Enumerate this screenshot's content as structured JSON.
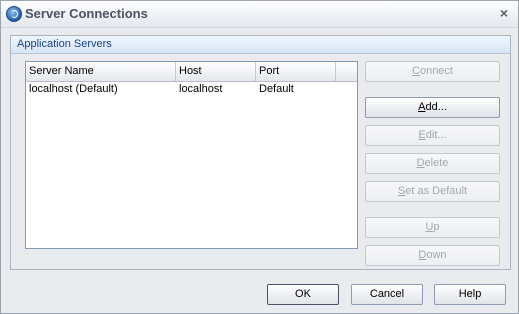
{
  "window": {
    "title": "Server Connections",
    "close_glyph": "×"
  },
  "group": {
    "title": "Application Servers"
  },
  "table": {
    "columns": [
      "Server Name",
      "Host",
      "Port"
    ],
    "rows": [
      {
        "name": "localhost (Default)",
        "host": "localhost",
        "port": "Default"
      }
    ]
  },
  "side_buttons": {
    "connect": {
      "label": "Connect",
      "access": "C",
      "rest": "onnect",
      "enabled": false
    },
    "add": {
      "label": "Add...",
      "access": "A",
      "rest": "dd...",
      "enabled": true
    },
    "edit": {
      "label": "Edit...",
      "access": "E",
      "rest": "dit...",
      "enabled": false
    },
    "delete": {
      "label": "Delete",
      "access": "D",
      "rest": "elete",
      "enabled": false
    },
    "set_default": {
      "label": "Set as Default",
      "access": "S",
      "rest": "et as Default",
      "enabled": false
    },
    "up": {
      "label": "Up",
      "access": "U",
      "rest": "p",
      "enabled": false
    },
    "down": {
      "label": "Down",
      "access": "D",
      "rest": "own",
      "enabled": false
    }
  },
  "footer_buttons": {
    "ok": "OK",
    "cancel": "Cancel",
    "help": "Help"
  },
  "icons": {
    "app": "server-connections-app-icon",
    "close": "close-icon"
  }
}
